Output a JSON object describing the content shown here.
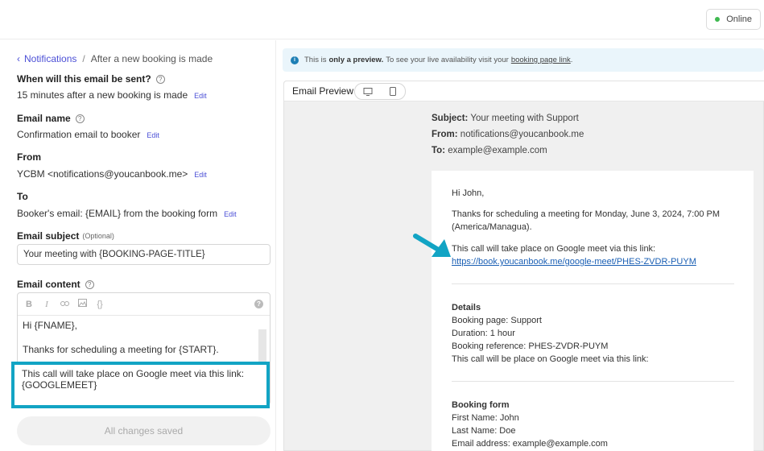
{
  "status": {
    "label": "Online",
    "color": "#3fb950"
  },
  "breadcrumb": {
    "parent": "Notifications",
    "separator": "/",
    "current": "After a new booking is made"
  },
  "fields": {
    "when": {
      "label": "When will this email be sent?",
      "value": "15 minutes after a new booking is made",
      "edit": "Edit"
    },
    "name": {
      "label": "Email name",
      "value": "Confirmation email to booker",
      "edit": "Edit"
    },
    "from": {
      "label": "From",
      "value": "YCBM <notifications@youcanbook.me>",
      "edit": "Edit"
    },
    "to": {
      "label": "To",
      "value": "Booker's email: {EMAIL} from the booking form",
      "edit": "Edit"
    },
    "subject": {
      "label": "Email subject",
      "optional": "(Optional)",
      "value": "Your meeting with {BOOKING-PAGE-TITLE}"
    },
    "content": {
      "label": "Email content",
      "toolbar": [
        "B",
        "I",
        "link-icon",
        "image-icon",
        "code-icon"
      ],
      "lines": [
        "Hi {FNAME},",
        "Thanks for scheduling a meeting for {START}."
      ],
      "highlight_lines": [
        "This call will take place on Google meet via this link:",
        "{GOOGLEMEET}"
      ]
    }
  },
  "save_button": "All changes saved",
  "banner": {
    "text_before": "This is",
    "bold": "only a preview.",
    "text_after": "To see your live availability visit your",
    "link": "booking page link",
    "end": "."
  },
  "preview": {
    "tab_label": "Email Preview",
    "subject_label": "Subject:",
    "subject": "Your meeting with Support",
    "from_label": "From:",
    "from": "notifications@youcanbook.me",
    "to_label": "To:",
    "to": "example@example.com",
    "body": {
      "greeting": "Hi John,",
      "thanks_1": "Thanks for scheduling a meeting for Monday, June 3, 2024, 7:00 PM",
      "thanks_2": "(America/Managua).",
      "call_line": "This call will take place on Google meet via this link:",
      "call_link": "https://book.youcanbook.me/google-meet/PHES-ZVDR-PUYM",
      "details_heading": "Details",
      "details": [
        "Booking page: Support",
        "Duration: 1 hour",
        "Booking reference: PHES-ZVDR-PUYM",
        "This call will be place on Google meet via this link:"
      ],
      "form_heading": "Booking form",
      "form": [
        "First Name: John",
        "Last Name: Doe",
        "Email address: example@example.com"
      ]
    }
  },
  "colors": {
    "accent": "#4b4fd6",
    "highlight": "#12a4c4",
    "arrow": "#12a4c4"
  }
}
